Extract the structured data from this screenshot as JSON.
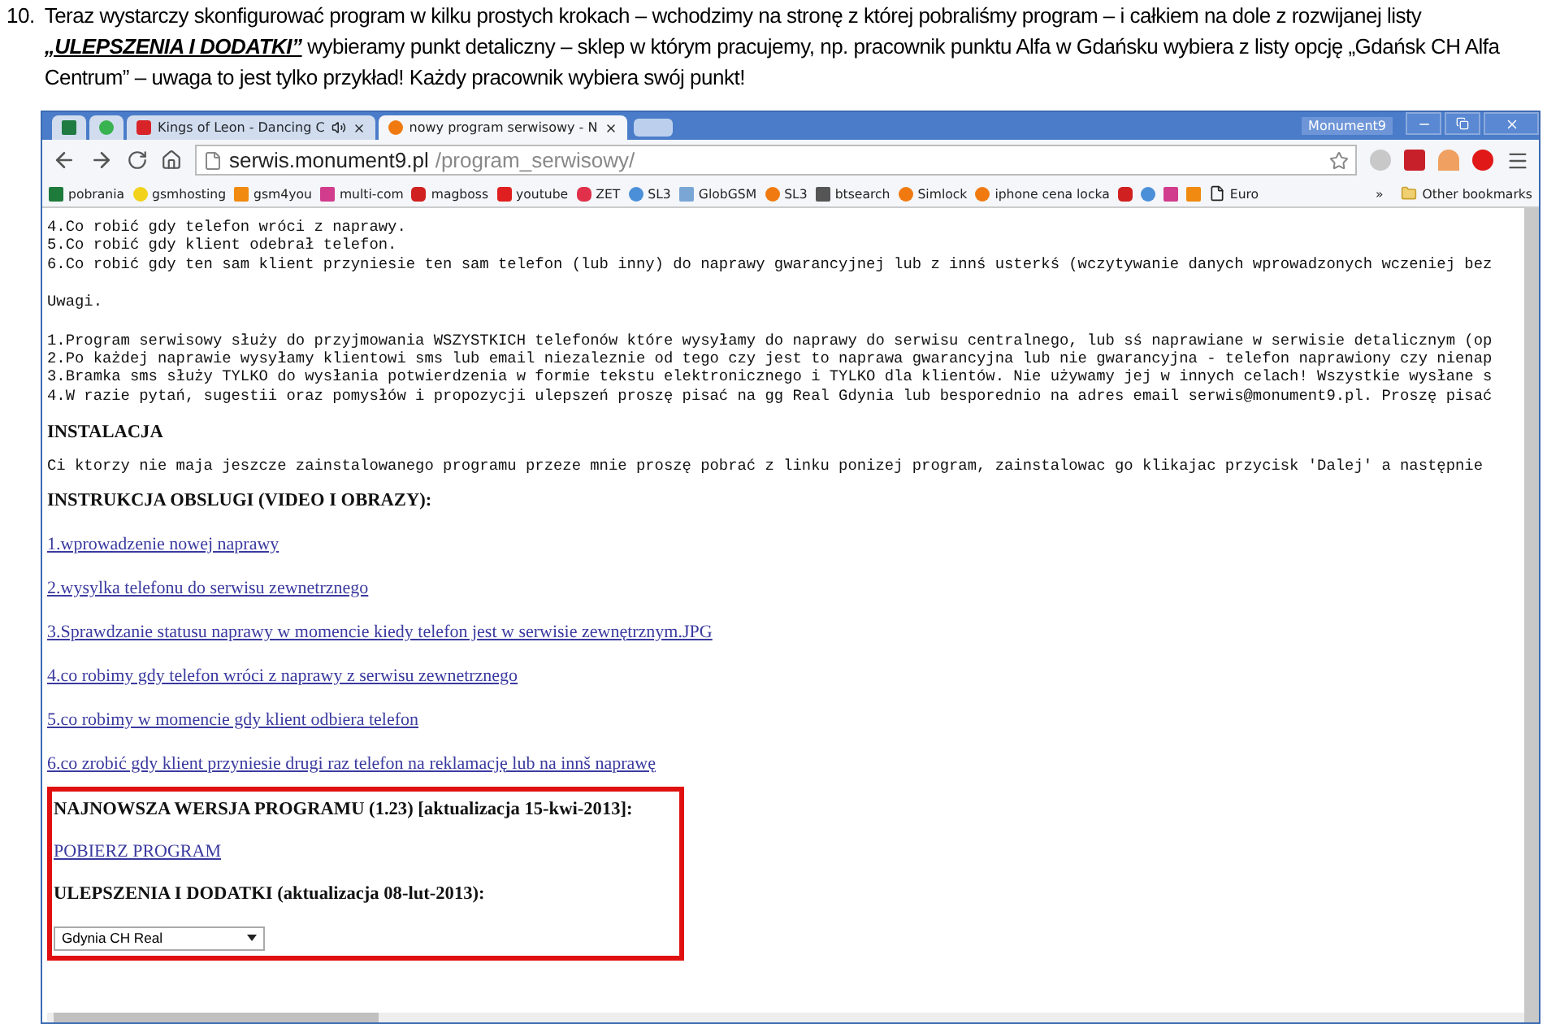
{
  "instruction": {
    "number": "10.",
    "before": "Teraz wystarczy skonfigurować program w kilku prostych krokach – wchodzimy na stronę z której pobraliśmy program – i całkiem na dole z rozwijanej listy ",
    "highlight": "„ULEPSZENIA I DODATKI”",
    "after": " wybieramy punkt detaliczny – sklep w którym pracujemy, np. pracownik punktu Alfa w Gdańsku wybiera z listy opcję „Gdańsk CH Alfa Centrum” – uwaga to jest tylko przykład! Każdy pracownik wybiera swój punkt!"
  },
  "browser": {
    "profile": "Monument9",
    "tabs": [
      {
        "kind": "icon",
        "selected": false
      },
      {
        "kind": "icon",
        "selected": false
      },
      {
        "kind": "page",
        "label": "Kings of Leon - Dancing C",
        "audio": true,
        "selected": false
      },
      {
        "kind": "page",
        "label": "nowy program serwisowy - N",
        "audio": false,
        "selected": true
      }
    ],
    "address": {
      "host": "serwis.monument9.pl",
      "path": "/program_serwisowy/"
    },
    "bookmarks": [
      {
        "kind": "labeled",
        "label": "pobrania"
      },
      {
        "kind": "labeled",
        "label": "gsmhosting"
      },
      {
        "kind": "labeled",
        "label": "gsm4you"
      },
      {
        "kind": "labeled",
        "label": "multi-com"
      },
      {
        "kind": "labeled",
        "label": "magboss"
      },
      {
        "kind": "labeled",
        "label": "youtube"
      },
      {
        "kind": "labeled",
        "label": "ZET"
      },
      {
        "kind": "labeled",
        "label": "SL3"
      },
      {
        "kind": "labeled",
        "label": "GlobGSM"
      },
      {
        "kind": "labeled",
        "label": "SL3"
      },
      {
        "kind": "labeled",
        "label": "btsearch"
      },
      {
        "kind": "labeled",
        "label": "Simlock"
      },
      {
        "kind": "labeled",
        "label": "iphone cena locka"
      },
      {
        "kind": "icon"
      },
      {
        "kind": "icon"
      },
      {
        "kind": "icon"
      },
      {
        "kind": "icon"
      },
      {
        "kind": "labeled",
        "label": "Euro"
      }
    ],
    "more_bookmarks": "»",
    "other_bookmarks": "Other bookmarks",
    "content": {
      "steps": [
        "4.Co robić gdy telefon wróci z naprawy.",
        "5.Co robić gdy klient odebrał telefon.",
        "6.Co robić gdy ten sam klient przyniesie ten sam telefon (lub inny) do naprawy gwarancyjnej lub z innś usterkś (wczytywanie danych wprowadzonych wczeniej bez"
      ],
      "notes_heading": "Uwagi.",
      "notes": [
        "1.Program serwisowy służy do przyjmowania WSZYSTKICH telefonów które wysyłamy do naprawy do serwisu centralnego, lub sś naprawiane w serwisie detalicznym (op",
        "2.Po każdej naprawie wysyłamy klientowi sms lub email niezaleznie od tego czy jest to naprawa gwarancyjna lub nie gwarancyjna - telefon naprawiony czy nienap",
        "3.Bramka sms służy TYLKO do wysłania potwierdzenia w formie tekstu elektronicznego i TYLKO dla klientów. Nie używamy jej w innych celach! Wszystkie wysłane s",
        "4.W razie pytań, sugestii oraz pomysłów i propozycji ulepszeń proszę pisać na gg Real Gdynia lub besporednio na adres email serwis@monument9.pl. Proszę pisać"
      ],
      "install_heading": "INSTALACJA",
      "install_text": "Ci ktorzy nie maja jeszcze zainstalowanego programu przeze mnie proszę pobrać z linku ponizej program, zainstalowac go klikajac przycisk 'Dalej' a następnie",
      "manual_heading": "INSTRUKCJA OBSLUGI (VIDEO I OBRAZY):",
      "manual_links": [
        "1.wprowadzenie nowej naprawy",
        "2.wysylka telefonu do serwisu zewnetrznego",
        "3.Sprawdzanie statusu naprawy w momencie kiedy telefon jest w serwisie zewnętrznym.JPG",
        "4.co robimy gdy telefon wróci z naprawy z serwisu zewnetrznego",
        "5.co robimy w momencie gdy klient odbiera telefon",
        "6.co zrobić gdy klient przyniesie drugi raz telefon na reklamację lub na innš naprawę"
      ],
      "highlight_box": {
        "version_heading": "NAJNOWSZA WERSJA PROGRAMU (1.23) [aktualizacja 15-kwi-2013]:",
        "download_link": "POBIERZ PROGRAM",
        "addons_heading": "ULEPSZENIA I DODATKI (aktualizacja 08-lut-2013):",
        "store_select": {
          "value": "Gdynia CH Real"
        }
      }
    }
  }
}
